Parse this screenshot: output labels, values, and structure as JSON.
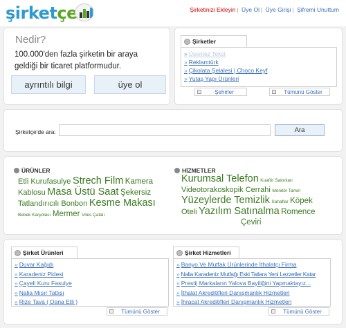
{
  "header": {
    "logo_text_a": "şirket",
    "logo_text_b": "çe",
    "links": [
      "Şirketinizi Ekleyin",
      "Üye Ol",
      "Üye Girişi",
      "Şifremi Unuttum"
    ],
    "sep": "|"
  },
  "about": {
    "title": "Nedir?",
    "text": "100.000'den fazla şirketin bir araya geldiği bir ticaret platformudur.",
    "btn_details": "ayrıntılı bilgi",
    "btn_signup": "üye ol"
  },
  "companies": {
    "tab": "Şirketler",
    "items": [
      "Üsentez Tekst",
      "Reklamtürk",
      "Çikolata Şelalesi | Choco Keyf",
      "Yutaş Yapı Ürünleri"
    ],
    "btn_cities": "Şehirler",
    "btn_all": "Tümünü Göster"
  },
  "search": {
    "label": "Şirketçe'de ara:",
    "value": "",
    "button": "Ara"
  },
  "products_cloud": {
    "title": "ÜRÜNLER",
    "words": [
      "Etli Kurufasulye",
      "Strech Film",
      "Kamera",
      "Kablosu",
      "Masa Üstü Saat",
      "Şekersiz",
      "Tatlandırıcılı Bonbon",
      "Kesme Makası",
      "Bebek Karyolası",
      "Mermer",
      "Vites Çatalı"
    ]
  },
  "services_cloud": {
    "title": "HİZMETLER",
    "words": [
      "Kurumsal Telefon",
      "Kuaför Salonları",
      "Videotorakoskopik Cerrahi",
      "Monitör Tamiri",
      "Yüzeylerde Temizlik",
      "Sahaflar",
      "Köpek",
      "Oteli",
      "Yazılım Satınalma",
      "Romence",
      "Çeviri"
    ]
  },
  "company_products": {
    "tab": "Şirket Ürünleri",
    "items": [
      "Duvar Kağıdı",
      "Karadeniz Pidesi",
      "Çayeli Kuru Fasulye",
      "Nalia Mısır Tatlısı",
      "Rize Tava ( Dana Etli )"
    ],
    "btn_all": "Tümünü Göster"
  },
  "company_services": {
    "tab": "Şirket Hizmetleri",
    "items": [
      "Banyo Ve Mutfak Ürünlerinde İthalatçı Firma",
      "Nalia Karadeniz Mutfağı Eski Tatlara Yeni Lezzetler Katar",
      "Prestij Markaların Yalova Bayiliğini Yapmaktayız...",
      "İthalat Akreditifleri Danışmanlık Hizmetleri",
      "İhracat Akreditifleri Danışmanlık Hizmetleri"
    ],
    "btn_all": "Tümünü Göster"
  },
  "icons": {
    "arrow": "»",
    "logo_chart": "bar-chart-icon"
  },
  "colors": {
    "brand_blue": "#2e9ad0",
    "brand_green": "#5aa822",
    "link_blue": "#3a6fb8",
    "cloud_green": "#3a7a21",
    "accent_red": "#cc0000"
  }
}
